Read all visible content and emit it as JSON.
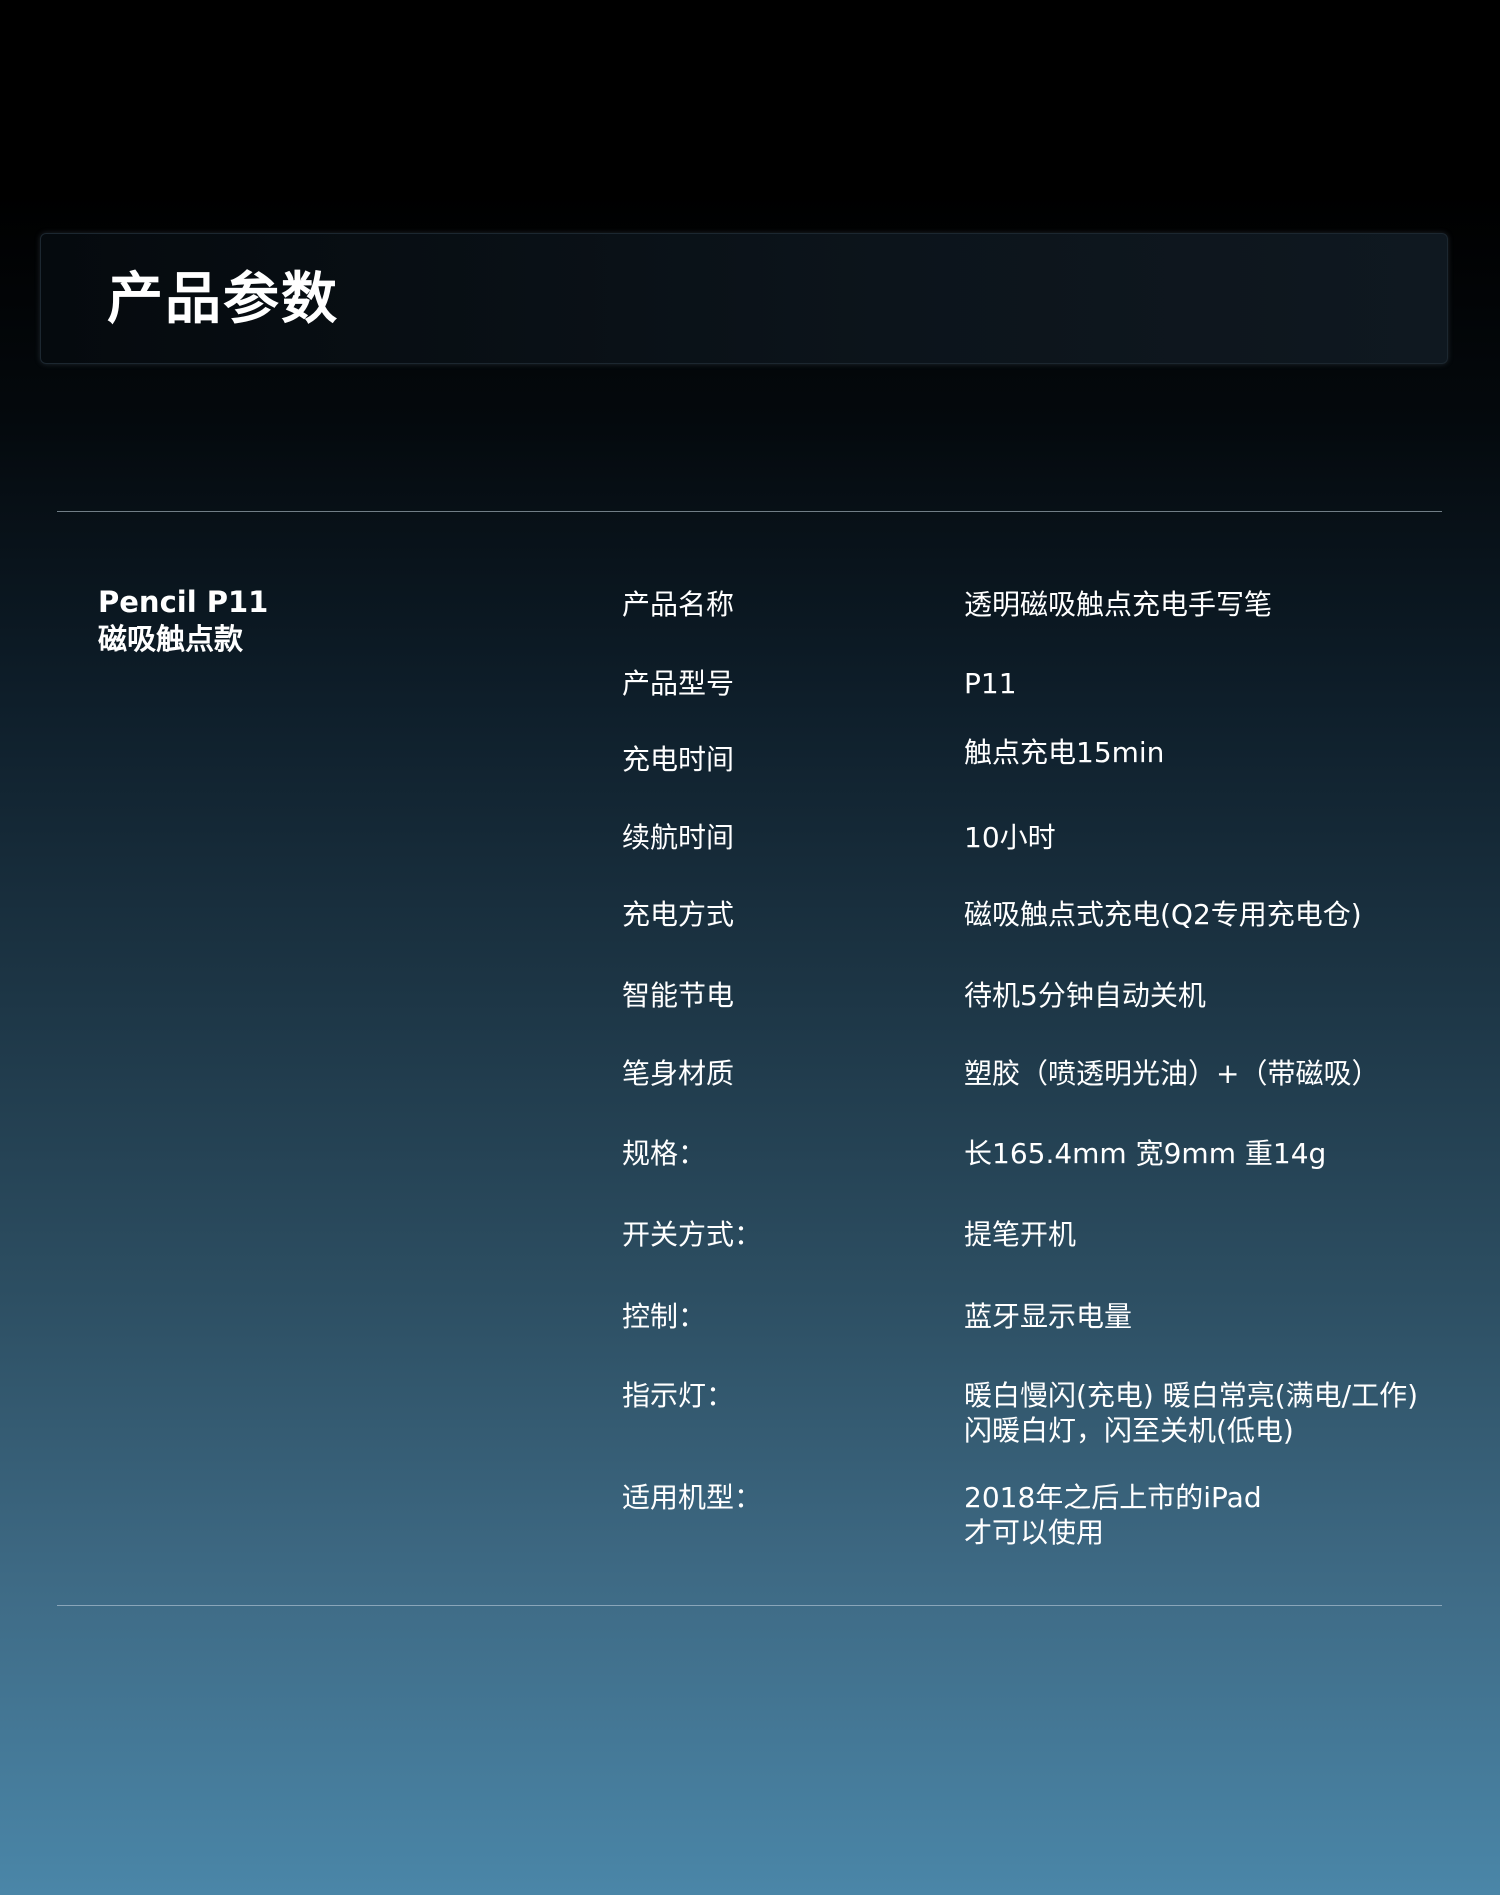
{
  "header": {
    "title": "产品参数"
  },
  "product": {
    "name": "Pencil P11",
    "subtitle": "磁吸触点款"
  },
  "specs": [
    {
      "label": "产品名称",
      "value": "透明磁吸触点充电手写笔"
    },
    {
      "label": "产品型号",
      "value": "P11"
    },
    {
      "label": "充电时间",
      "value": "触点充电15min"
    },
    {
      "label": "续航时间",
      "value": "10小时"
    },
    {
      "label": "充电方式",
      "value": "磁吸触点式充电(Q2专用充电仓)"
    },
    {
      "label": "智能节电",
      "value": "待机5分钟自动关机"
    },
    {
      "label": "笔身材质",
      "value": "塑胶（喷透明光油）+（带磁吸）"
    },
    {
      "label": "规格：",
      "value": "长165.4mm 宽9mm 重14g"
    },
    {
      "label": "开关方式：",
      "value": "提笔开机"
    },
    {
      "label": "控制：",
      "value": "蓝牙显示电量"
    },
    {
      "label": "指示灯：",
      "value": "暖白慢闪(充电) 暖白常亮(满电/工作)",
      "value2": "闪暖白灯，闪至关机(低电)"
    },
    {
      "label": "适用机型：",
      "value": "2018年之后上市的iPad",
      "value2": "才可以使用"
    }
  ]
}
